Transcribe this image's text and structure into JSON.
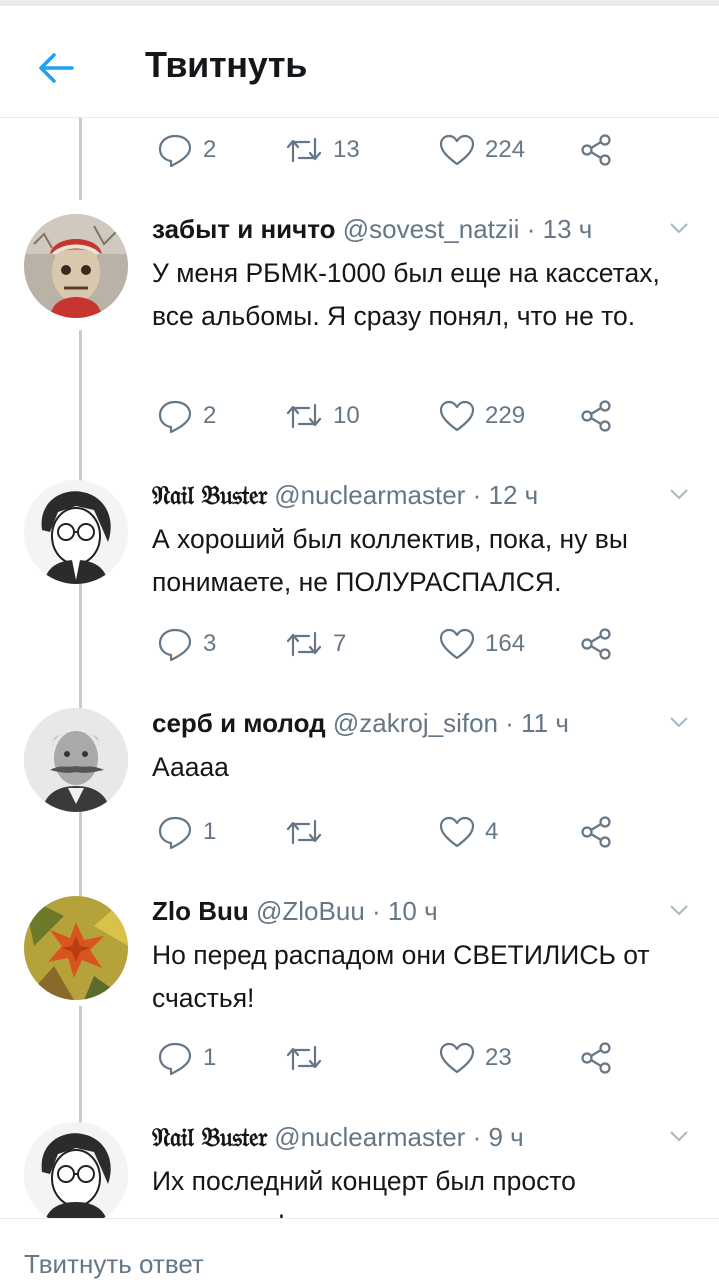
{
  "header": {
    "title": "Твитнуть"
  },
  "top_actions": {
    "replies": "2",
    "retweets": "13",
    "likes": "224"
  },
  "tweets": [
    {
      "name": "забыт и ничто",
      "handle": "@sovest_natzii",
      "time": "13 ч",
      "text": "У меня РБМК-1000 был еще на кассетах, все альбомы. Я сразу понял, что не то.",
      "replies": "2",
      "retweets": "10",
      "likes": "229"
    },
    {
      "name": "𝔑𝔞𝔦𝔩 𝔅𝔲𝔰𝔱𝔢𝔯",
      "handle": "@nuclearmaster",
      "time": "12 ч",
      "text": "А хороший был коллектив, пока, ну вы понимаете, не ПОЛУРАСПАЛСЯ.",
      "replies": "3",
      "retweets": "7",
      "likes": "164"
    },
    {
      "name": "серб и молод",
      "handle": "@zakroj_sifon",
      "time": "11 ч",
      "text": "Ааааа",
      "replies": "1",
      "retweets": "",
      "likes": "4"
    },
    {
      "name": "Zlo Buu",
      "handle": "@ZloBuu",
      "time": "10 ч",
      "text": "Но перед распадом они СВЕТИЛИСЬ от счастья!",
      "replies": "1",
      "retweets": "",
      "likes": "23"
    },
    {
      "name": "𝔑𝔞𝔦𝔩 𝔅𝔲𝔰𝔱𝔢𝔯",
      "handle": "@nuclearmaster",
      "time": "9 ч",
      "text": "Их последний концерт был просто взрывным!"
    }
  ],
  "separator": "·",
  "reply_bar": {
    "placeholder": "Твитнуть ответ"
  },
  "colors": {
    "accent": "#1da1f2",
    "muted": "#657786",
    "text": "#14171a",
    "thread": "#c5ccd3"
  }
}
